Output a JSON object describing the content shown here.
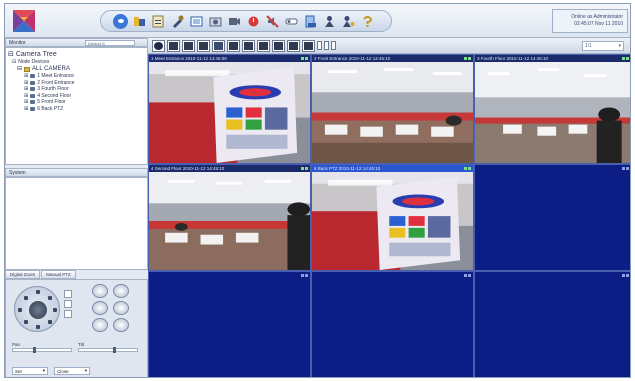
{
  "app": {
    "title_bar_status": [
      "Online as Administrator",
      "02:45:07 Nov 11 2010"
    ]
  },
  "toolbar": {
    "icons": [
      "live-view-icon",
      "playback-icon",
      "event-log-icon",
      "settings-icon",
      "fullscreen-icon",
      "snapshot-icon",
      "record-icon",
      "alarm-icon",
      "mute-icon",
      "io-icon",
      "backup-icon",
      "user-icon",
      "user-settings-icon",
      "help-icon"
    ]
  },
  "left_panel": {
    "tree_header": "Monitor",
    "group_select": "Default G",
    "tree": {
      "root": "Camera Tree",
      "site": "Node Devices",
      "group": "ALL CAMERA",
      "cameras": [
        "1 Meet Entrance",
        "2 Front Entrance",
        "3 Fourth Floor",
        "4 Second Floor",
        "5 Front Floor",
        "6 Back PTZ"
      ]
    },
    "system_header": "System",
    "tabs": [
      "Digital Zoom",
      "Manual PTZ"
    ],
    "ptz": {
      "speed_label": "Pan",
      "speed_value": 0.35,
      "focus_label": "Tilt",
      "focus_value": 0.6,
      "preset_select": "Set",
      "preset_select2": "Close"
    }
  },
  "layout_bar": {
    "page_select": "1/1"
  },
  "video_grid": {
    "cells": [
      {
        "title": "1 Meet Entrance  2010-11-12 14:45:09",
        "status": "live",
        "scene": "poster"
      },
      {
        "title": "2 Front Entrance  2010-11-12 14:45:10",
        "status": "live",
        "scene": "office"
      },
      {
        "title": "3 Fourth Floor  2010-11-12 14:45:10",
        "status": "live",
        "scene": "office-person"
      },
      {
        "title": "4 Second Floor  2010-11-12 14:45:10",
        "status": "live",
        "scene": "office2"
      },
      {
        "title": "6 Back PTZ  2010-11-12 14:45:10",
        "status": "active",
        "scene": "poster"
      },
      {
        "title": "",
        "status": "empty"
      },
      {
        "title": "",
        "status": "empty"
      },
      {
        "title": "",
        "status": "empty"
      },
      {
        "title": "",
        "status": "empty"
      }
    ]
  },
  "colors": {
    "empty_cell": "#0c1e85",
    "active_title": "#2a56d0",
    "panel_bg": "#e4eaf3"
  }
}
